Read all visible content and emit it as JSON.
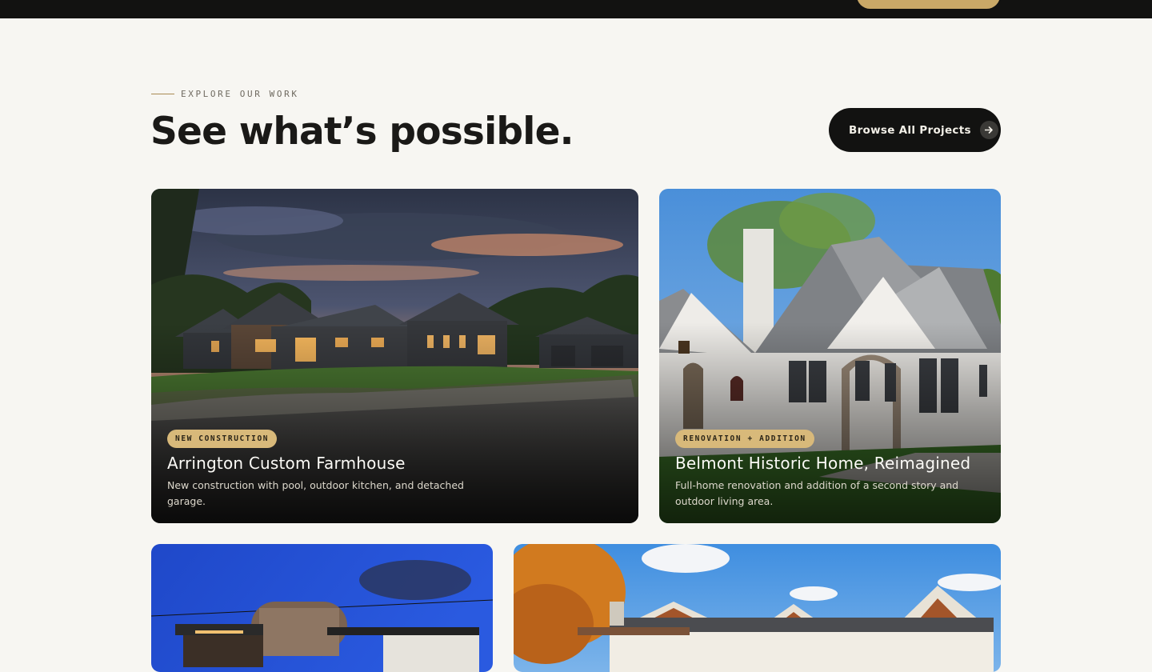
{
  "section": {
    "eyebrow": "EXPLORE OUR WORK",
    "headline": "See what’s possible.",
    "browse_label": "Browse All Projects",
    "browse_icon": "arrow-right-icon"
  },
  "projects": [
    {
      "tag": "NEW CONSTRUCTION",
      "title": "Arrington Custom Farmhouse",
      "description": "New construction with pool, outdoor kitchen, and detached garage."
    },
    {
      "tag": "RENOVATION + ADDITION",
      "title": "Belmont Historic Home, Reimagined",
      "description": "Full-home renovation and addition of a second story and outdoor living area."
    }
  ],
  "colors": {
    "background": "#f7f6f2",
    "accent": "#d8b97a",
    "dark": "#121211"
  }
}
